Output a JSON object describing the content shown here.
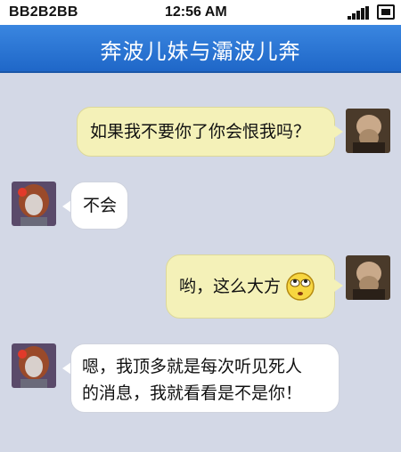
{
  "status_bar": {
    "carrier": "BB2B2BB",
    "time": "12:56 AM",
    "icons": [
      "signal-icon",
      "battery-icon"
    ]
  },
  "header": {
    "title": "奔波儿妹与灞波儿奔"
  },
  "messages": [
    {
      "side": "right",
      "avatar": "bald-man-avatar",
      "text": "如果我不要你了你会恨我吗？"
    },
    {
      "side": "left",
      "avatar": "girl-avatar",
      "text": "不会"
    },
    {
      "side": "right",
      "avatar": "bald-man-avatar",
      "text": "哟，这么大方",
      "emoji": "rolling-eyes-emoji"
    },
    {
      "side": "left",
      "avatar": "girl-avatar",
      "lines": [
        "嗯，我顶多就是每次听见死人",
        "的消息，我就看看是不是你！"
      ]
    }
  ],
  "colors": {
    "background": "#d3d8e6",
    "header": "#2a76d6",
    "bubble_right": "#f4f1b8",
    "bubble_left": "#ffffff"
  }
}
